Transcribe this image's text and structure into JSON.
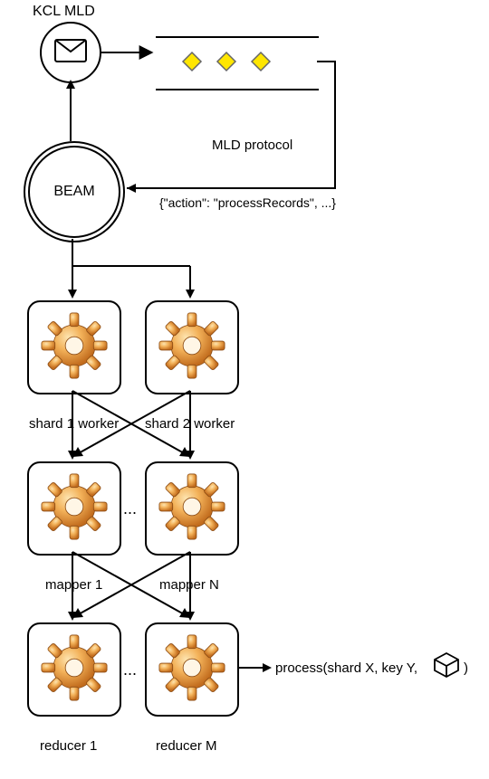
{
  "title": "KCL MLD",
  "protocol_label": "MLD protocol",
  "action_line": "{\"action\": \"processRecords\", ...}",
  "beam_label": "BEAM",
  "row_workers": {
    "left": "shard 1 worker",
    "right": "shard 2 worker"
  },
  "row_mappers": {
    "left": "mapper 1",
    "right": "mapper N"
  },
  "row_reducers": {
    "left": "reducer 1",
    "right": "reducer M"
  },
  "process_call_prefix": "process(shard X, key Y, ",
  "process_call_suffix": ")",
  "ellipsis": "...",
  "colors": {
    "accent_yellow": "#FFE600",
    "gear_orange": "#E8A23A",
    "gear_highlight": "#FBD38D",
    "gear_dark": "#B8691E"
  }
}
